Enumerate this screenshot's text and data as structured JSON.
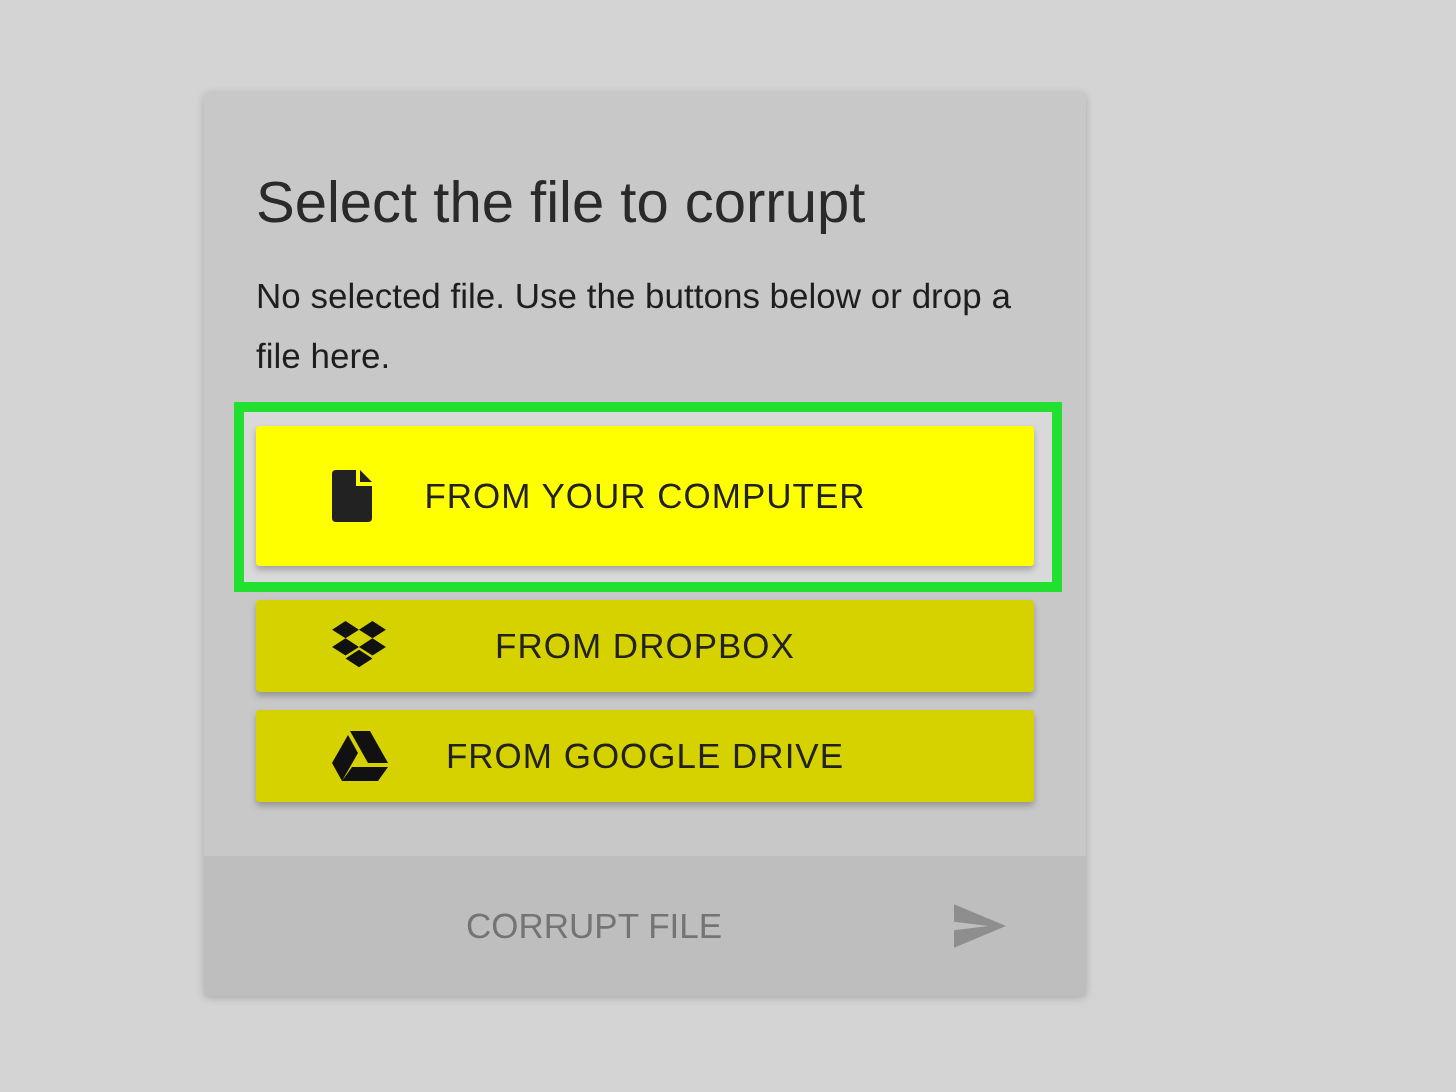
{
  "card": {
    "title": "Select the file to corrupt",
    "description": "No selected file. Use the buttons below or drop a file here.",
    "sources": [
      {
        "kind": "file",
        "label": "FROM YOUR COMPUTER",
        "highlighted": true
      },
      {
        "kind": "dropbox",
        "label": "FROM DROPBOX",
        "highlighted": false
      },
      {
        "kind": "drive",
        "label": "FROM GOOGLE DRIVE",
        "highlighted": false
      }
    ],
    "action": {
      "label": "CORRUPT FILE",
      "disabled": true
    }
  }
}
